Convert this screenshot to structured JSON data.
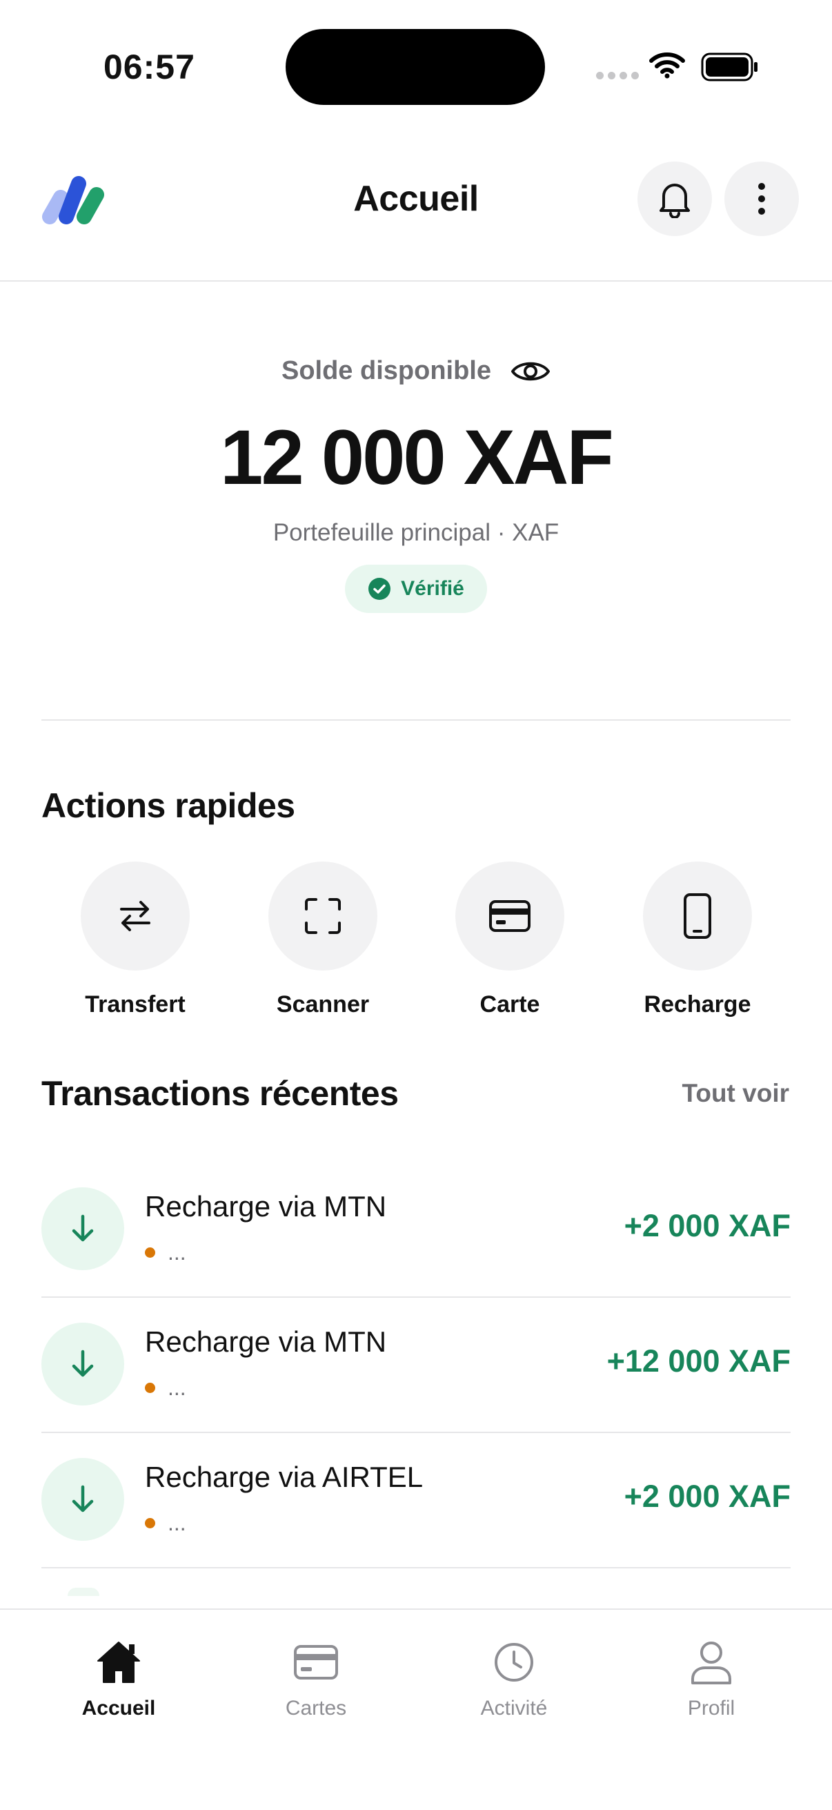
{
  "status_bar": {
    "time": "06:57"
  },
  "header": {
    "title": "Accueil"
  },
  "balance": {
    "label": "Solde disponible",
    "amount": "12 000 XAF",
    "wallet": "Portefeuille principal · XAF",
    "badge": "Vérifié"
  },
  "quick_actions": {
    "title": "Actions rapides",
    "items": [
      {
        "label": "Transfert",
        "icon": "transfer-arrows-icon"
      },
      {
        "label": "Scanner",
        "icon": "scan-frame-icon"
      },
      {
        "label": "Carte",
        "icon": "credit-card-icon"
      },
      {
        "label": "Recharge",
        "icon": "phone-icon"
      }
    ]
  },
  "transactions": {
    "title": "Transactions récentes",
    "see_all": "Tout voir",
    "items": [
      {
        "name": "Recharge via MTN",
        "status": "...",
        "amount": "+2 000 XAF"
      },
      {
        "name": "Recharge via MTN",
        "status": "...",
        "amount": "+12 000 XAF"
      },
      {
        "name": "Recharge via AIRTEL",
        "status": "...",
        "amount": "+2 000 XAF"
      }
    ]
  },
  "nav": {
    "items": [
      {
        "label": "Accueil",
        "icon": "home-icon",
        "active": true
      },
      {
        "label": "Cartes",
        "icon": "card-icon",
        "active": false
      },
      {
        "label": "Activité",
        "icon": "clock-icon",
        "active": false
      },
      {
        "label": "Profil",
        "icon": "user-icon",
        "active": false
      }
    ]
  },
  "colors": {
    "accent_green": "#17855a",
    "pending_orange": "#d97706",
    "muted_text": "#6e6e73",
    "surface": "#f2f2f3"
  }
}
